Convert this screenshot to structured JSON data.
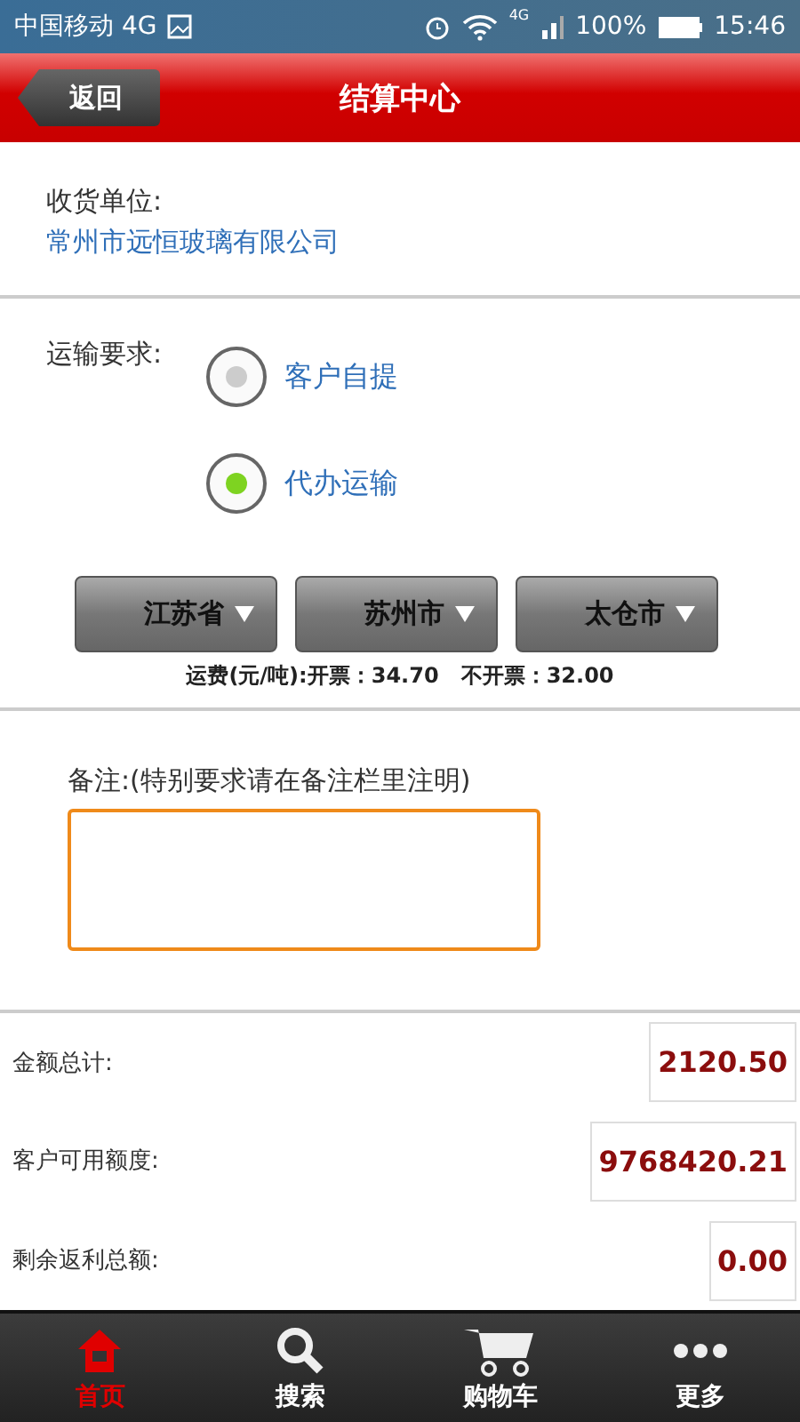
{
  "status_bar": {
    "carrier": "中国移动 4G",
    "network": "4G",
    "battery": "100%",
    "time": "15:46"
  },
  "header": {
    "back": "返回",
    "title": "结算中心"
  },
  "consignee": {
    "label": "收货单位:",
    "value": "常州市远恒玻璃有限公司"
  },
  "transport": {
    "label": "运输要求:",
    "options": [
      {
        "label": "客户自提",
        "selected": false
      },
      {
        "label": "代办运输",
        "selected": true
      }
    ]
  },
  "regions": [
    "江苏省",
    "苏州市",
    "太仓市"
  ],
  "freight": "运费(元/吨):开票：34.70   不开票：32.00",
  "remark": {
    "label": "备注:(特别要求请在备注栏里注明)"
  },
  "totals": [
    {
      "label": "金额总计:",
      "value": "2120.50"
    },
    {
      "label": "客户可用额度:",
      "value": "9768420.21"
    },
    {
      "label": "剩余返利总额:",
      "value": "0.00"
    }
  ],
  "tabs": [
    {
      "label": "首页",
      "kind": "home",
      "selected": true
    },
    {
      "label": "搜索",
      "kind": "search",
      "selected": false
    },
    {
      "label": "购物车",
      "kind": "cart",
      "selected": false
    },
    {
      "label": "更多",
      "kind": "more",
      "selected": false
    }
  ]
}
